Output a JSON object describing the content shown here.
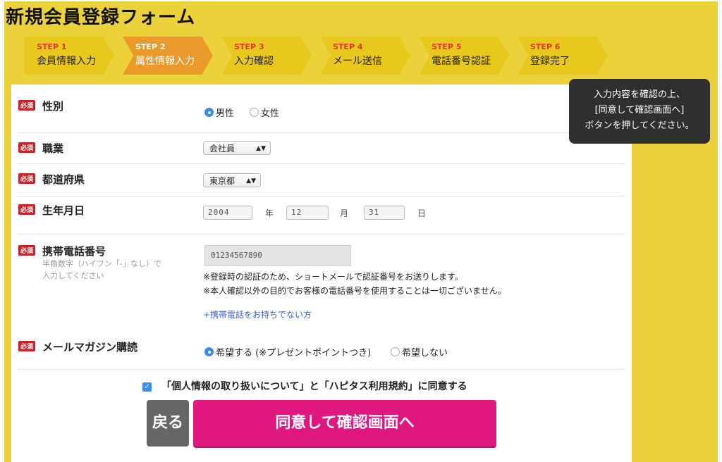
{
  "page_title": "新規会員登録フォーム",
  "steps": [
    {
      "num": "STEP 1",
      "label": "会員情報入力"
    },
    {
      "num": "STEP 2",
      "label": "属性情報入力"
    },
    {
      "num": "STEP 3",
      "label": "入力確認"
    },
    {
      "num": "STEP 4",
      "label": "メール送信"
    },
    {
      "num": "STEP 5",
      "label": "電話番号認証"
    },
    {
      "num": "STEP 6",
      "label": "登録完了"
    }
  ],
  "active_step": 2,
  "required_badge": "必須",
  "gender": {
    "label": "性別",
    "options": [
      "男性",
      "女性"
    ],
    "selected": "男性"
  },
  "occupation": {
    "label": "職業",
    "value": "会社員"
  },
  "prefecture": {
    "label": "都道府県",
    "value": "東京都"
  },
  "birthdate": {
    "label": "生年月日",
    "year": "2004",
    "month": "12",
    "day": "31",
    "year_unit": "年",
    "month_unit": "月",
    "day_unit": "日"
  },
  "phone": {
    "label": "携帯電話番号",
    "help_line1": "半角数字（ハイフン「-」なし）で",
    "help_line2": "入力してください",
    "value": "01234567890",
    "note1": "※登録時の認証のため、ショートメールで認証番号をお送りします。",
    "note2": "※本人確認以外の目的でお客様の電話番号を使用することは一切ございません。",
    "no_phone_link": "+携帯電話をお持ちでない方"
  },
  "magazine": {
    "label": "メールマガジン購読",
    "options": [
      "希望する (※プレゼントポイントつき)",
      "希望しない"
    ],
    "selected": "希望する (※プレゼントポイントつき)"
  },
  "agreement": {
    "text": "「個人情報の取り扱いについて」と「ハピタス利用規約」に同意する",
    "checked": true
  },
  "buttons": {
    "back": "戻る",
    "submit": "同意して確認画面へ"
  },
  "tooltip": {
    "line1": "入力内容を確認の上、",
    "line2": "[同意して確認画面へ]",
    "line3": "ボタンを押してください。"
  },
  "colors": {
    "background": "#ecd23a",
    "active_step": "#ea9a2a",
    "required": "#c8232b",
    "submit": "#e0177f",
    "link": "#3a5fd0"
  }
}
